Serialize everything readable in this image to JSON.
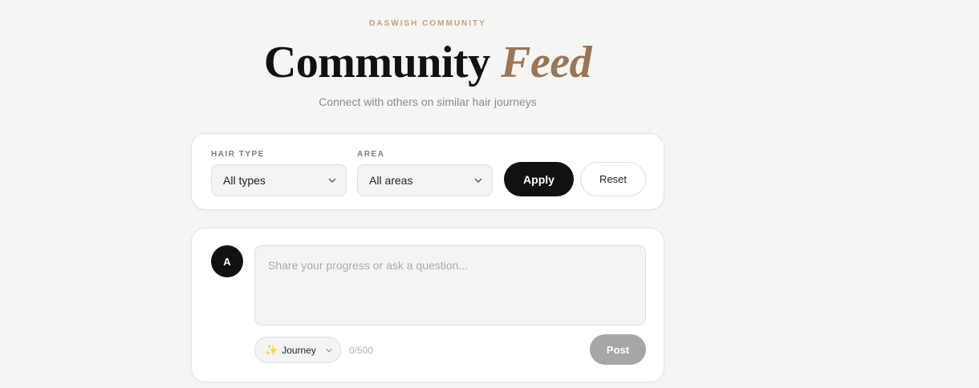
{
  "header": {
    "eyebrow": "DASWISH COMMUNITY",
    "title_main": "Community",
    "title_accent": "Feed",
    "subtitle": "Connect with others on similar hair journeys"
  },
  "filters": {
    "hair_type_label": "HAIR TYPE",
    "hair_type_value": "All types",
    "area_label": "AREA",
    "area_value": "All areas",
    "apply_label": "Apply",
    "reset_label": "Reset"
  },
  "composer": {
    "avatar_initial": "A",
    "placeholder": "Share your progress or ask a question...",
    "category_emoji": "✨",
    "category_label": "Journey",
    "char_count": "0/500",
    "post_label": "Post"
  },
  "colors": {
    "accent": "#9a7556",
    "eyebrow": "#c9a27a",
    "primary_button": "#111111",
    "disabled_button": "#a6a6a6"
  }
}
